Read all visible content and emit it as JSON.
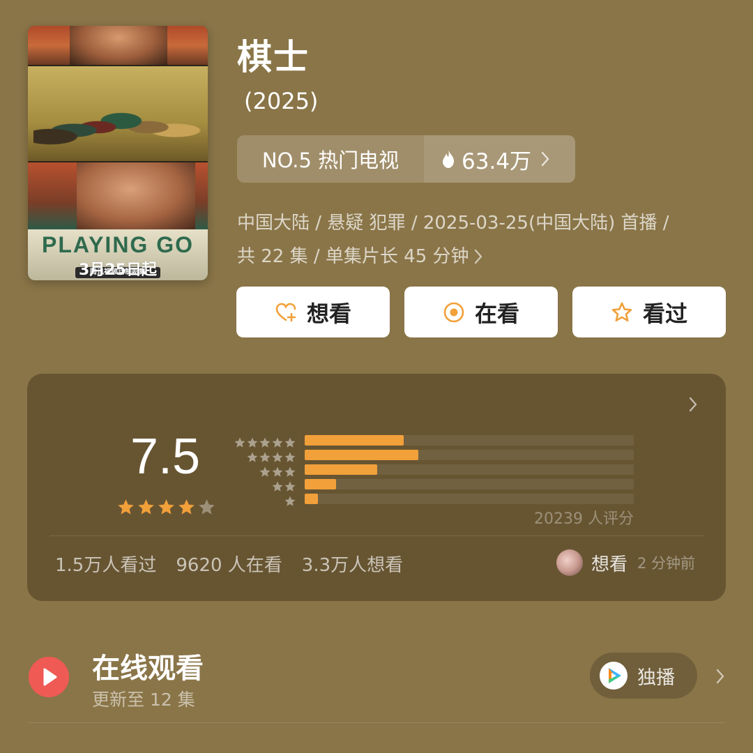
{
  "poster": {
    "title_art": "PLAYING GO",
    "subtitle_badge": "腾讯视频自制剧集",
    "date_text": "3月25日起"
  },
  "title": "棋士",
  "year": "(2025)",
  "rank": {
    "label": "NO.5 热门电视",
    "heat": "63.4万"
  },
  "meta": {
    "line1": "中国大陆 / 悬疑 犯罪 / 2025-03-25(中国大陆) 首播 /",
    "line2": "共 22 集 / 单集片长 45 分钟"
  },
  "actions": {
    "want": "想看",
    "watching": "在看",
    "watched": "看过"
  },
  "rating": {
    "score": "7.5",
    "stars": 4,
    "distribution_percent": [
      30,
      34.5,
      22,
      9.5,
      4
    ],
    "count_text": "20239 人评分",
    "stats": [
      "1.5万人看过",
      "9620 人在看",
      "3.3万人想看"
    ],
    "activity_label": "想看",
    "activity_time": "2 分钟前"
  },
  "online": {
    "title": "在线观看",
    "subtitle": "更新至 12 集",
    "badge": "独播"
  },
  "colors": {
    "background": "#8a7548",
    "card": "#675532",
    "accent_orange": "#f2a03a",
    "play_red": "#ef5a55"
  },
  "icons": [
    "flame-icon",
    "chevron-right-icon",
    "heart-plus-icon",
    "target-icon",
    "star-outline-icon",
    "star-icon",
    "play-icon",
    "tencent-video-icon"
  ]
}
